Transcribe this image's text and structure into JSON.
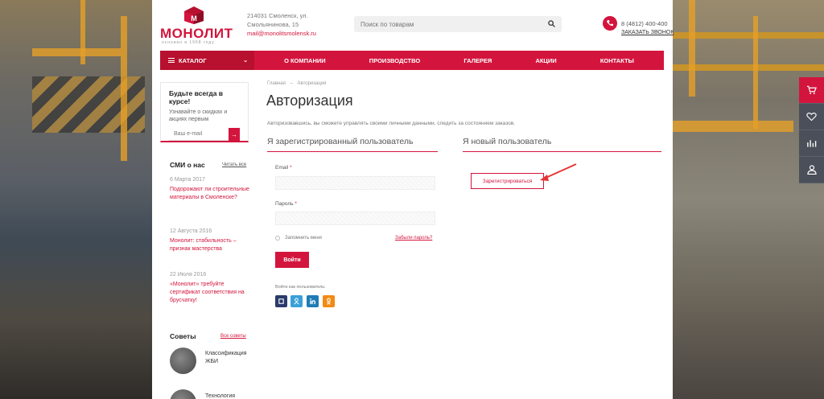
{
  "header": {
    "logo_text": "МОНОЛИТ",
    "logo_tagline": "основан в 1968 году",
    "address_line1": "214031 Смоленск, ул.",
    "address_line2": "Смольянинова, 15",
    "email": "mail@monolitsmolensk.ru",
    "search_placeholder": "Поиск по товарам",
    "phone": "8 (4812) 400-400",
    "callback": "ЗАКАЗАТЬ ЗВОНОК"
  },
  "nav": {
    "catalog": "КАТАЛОГ",
    "items": [
      "О КОМПАНИИ",
      "ПРОИЗВОДСТВО",
      "ГАЛЕРЕЯ",
      "АКЦИИ",
      "КОНТАКТЫ"
    ]
  },
  "sidebar": {
    "subscribe_title": "Будьте всегда в курсе!",
    "subscribe_text": "Узнавайте о скидках и акциях первым",
    "email_placeholder": "Ваш e-mail",
    "smi_title": "СМИ о нас",
    "smi_all": "Читать все",
    "news": [
      {
        "date": "6 Марта 2017",
        "title": "Подорожают ли строительные материалы в Смоленске?"
      },
      {
        "date": "12 Августа 2016",
        "title": "Монолит: стабильность – признак мастерства"
      },
      {
        "date": "22 Июля 2016",
        "title": "«Монолит» требуйте сертификат соответствия на брусчатку!"
      }
    ],
    "tips_title": "Советы",
    "tips_all": "Все советы",
    "tips": [
      {
        "title": "Классификация ЖБИ"
      },
      {
        "title": "Технология"
      }
    ]
  },
  "main": {
    "breadcrumb_home": "Главная",
    "breadcrumb_sep": "–",
    "breadcrumb_current": "Авторизация",
    "title": "Авторизация",
    "intro": "Авторизовавшись, вы сможете управлять своими личными данными, следить за состоянием заказов.",
    "registered_title": "Я зарегистрированный пользователь",
    "new_title": "Я новый пользователь",
    "email_label": "Email",
    "password_label": "Пароль",
    "required_mark": "*",
    "remember": "Запомнить меня",
    "forgot": "Забыли пароль?",
    "login_button": "Войти",
    "social_label": "Войти как пользователь:",
    "social": [
      "vk-icon",
      "ok-icon",
      "linkedin-icon",
      "odnoklassniki-icon"
    ],
    "register_button": "Зарегистрироваться"
  },
  "colors": {
    "brand_red": "#d3153d",
    "sidebar_dark": "#4a4f59"
  }
}
